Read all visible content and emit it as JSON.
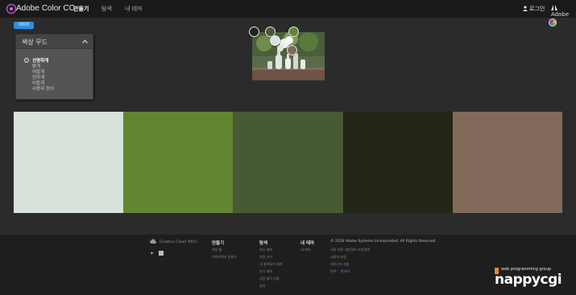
{
  "header": {
    "app_title": "Adobe Color CC",
    "nav": [
      {
        "label": "만들기",
        "active": true
      },
      {
        "label": "탐색",
        "active": false
      },
      {
        "label": "내 테마",
        "active": false
      }
    ],
    "login_label": "로그인",
    "adobe_label": "Adobe"
  },
  "toolbar": {
    "image_button_label": "이미지"
  },
  "mood_panel": {
    "title": "색상 무드",
    "options": [
      {
        "label": "선명하게",
        "selected": true
      },
      {
        "label": "밝게",
        "selected": false
      },
      {
        "label": "어둡게",
        "selected": false
      },
      {
        "label": "진하게",
        "selected": false
      },
      {
        "label": "어둡게",
        "selected": false
      },
      {
        "label": "사용자 정의",
        "selected": false
      }
    ]
  },
  "swatches": [
    {
      "color": "#d7e2db"
    },
    {
      "color": "#628532"
    },
    {
      "color": "#475a34"
    },
    {
      "color": "#232516"
    },
    {
      "color": "#826a5b"
    }
  ],
  "footer": {
    "cc_text": "Creative Cloud 서비스",
    "columns": [
      {
        "title": "만들기",
        "links": [
          "색상 휠",
          "이미지에서 만들기"
        ]
      },
      {
        "title": "탐색",
        "links": [
          "최신 테마",
          "가장 인기",
          "내 즐겨찾기 테마",
          "인기 테마",
          "가장 많이 사용",
          "임의"
        ]
      },
      {
        "title": "내 테마",
        "links": [
          "내 테마"
        ]
      }
    ],
    "copyright": "© 2016 Adobe Systems Incorporated. All Rights Reserved.",
    "legal_links": [
      "사용 약관",
      "개인정보 보호정책",
      "사용자 포럼",
      "커뮤니티 지침"
    ],
    "language_label": "언어:",
    "language_value": "한국어"
  },
  "watermark": {
    "small": "web programming group",
    "big": "nappycgi"
  },
  "colors": {
    "topbar": "#1a1a1a",
    "background": "#2b2b2b",
    "accent": "#2d8ee0",
    "footer": "#1e1e1e"
  }
}
